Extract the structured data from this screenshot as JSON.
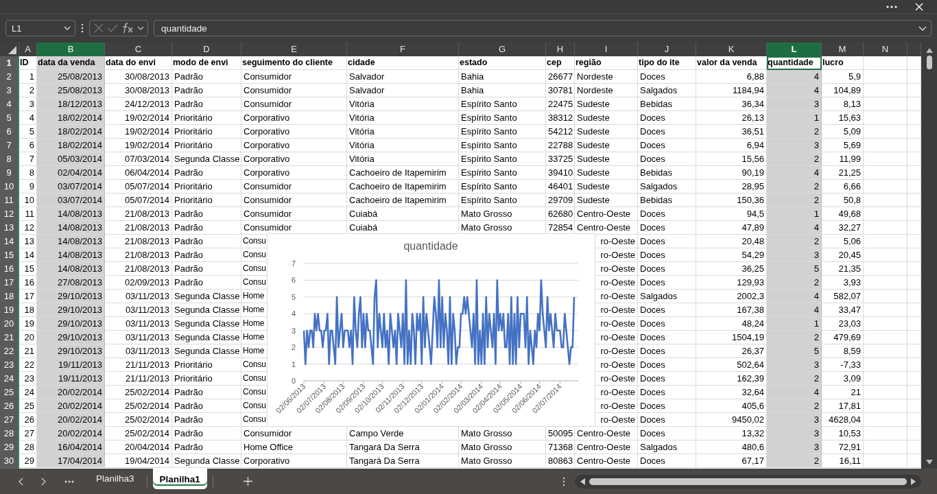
{
  "formula_bar": {
    "name_box": "L1",
    "formula": "quantidade"
  },
  "columns": [
    {
      "letter": "A",
      "selected": false,
      "active": false
    },
    {
      "letter": "B",
      "selected": true,
      "active": false
    },
    {
      "letter": "C",
      "selected": false,
      "active": false
    },
    {
      "letter": "D",
      "selected": false,
      "active": false
    },
    {
      "letter": "E",
      "selected": false,
      "active": false
    },
    {
      "letter": "F",
      "selected": false,
      "active": false
    },
    {
      "letter": "G",
      "selected": false,
      "active": false
    },
    {
      "letter": "H",
      "selected": false,
      "active": false
    },
    {
      "letter": "I",
      "selected": false,
      "active": false
    },
    {
      "letter": "J",
      "selected": false,
      "active": false
    },
    {
      "letter": "K",
      "selected": false,
      "active": false
    },
    {
      "letter": "L",
      "selected": true,
      "active": true
    },
    {
      "letter": "M",
      "selected": false,
      "active": false
    },
    {
      "letter": "N",
      "selected": false,
      "active": false
    }
  ],
  "rows": [
    {
      "number": "1",
      "kind": "header",
      "selected": true,
      "active": true,
      "cells": [
        "ID",
        "data da venda",
        "data do envi",
        "modo de envi",
        "seguimento do cliente",
        "cidade",
        "estado",
        "cep",
        "região",
        "tipo do ite",
        "valor da venda",
        "quantidade",
        "lucro"
      ]
    },
    {
      "number": "2",
      "kind": "data",
      "selected": true,
      "active": false,
      "cells": [
        "1",
        "25/08/2013",
        "30/08/2013",
        "Padrão",
        "Consumidor",
        "Salvador",
        "Bahia",
        "26677",
        "Nordeste",
        "Doces",
        "6,88",
        "4",
        "5,9"
      ]
    },
    {
      "number": "3",
      "kind": "data",
      "selected": true,
      "active": false,
      "cells": [
        "2",
        "25/08/2013",
        "30/08/2013",
        "Padrão",
        "Consumidor",
        "Salvador",
        "Bahia",
        "30781",
        "Nordeste",
        "Salgados",
        "1184,94",
        "4",
        "104,89"
      ]
    },
    {
      "number": "4",
      "kind": "data",
      "selected": true,
      "active": false,
      "cells": [
        "3",
        "18/12/2013",
        "24/12/2013",
        "Padrão",
        "Consumidor",
        "Vitória",
        "Espírito Santo",
        "22475",
        "Sudeste",
        "Bebidas",
        "36,34",
        "3",
        "8,13"
      ]
    },
    {
      "number": "5",
      "kind": "data",
      "selected": true,
      "active": false,
      "cells": [
        "4",
        "18/02/2014",
        "19/02/2014",
        "Prioritário",
        "Corporativo",
        "Vitória",
        "Espírito Santo",
        "38312",
        "Sudeste",
        "Doces",
        "26,13",
        "1",
        "15,63"
      ]
    },
    {
      "number": "6",
      "kind": "data",
      "selected": true,
      "active": false,
      "cells": [
        "5",
        "18/02/2014",
        "19/02/2014",
        "Prioritário",
        "Corporativo",
        "Vitória",
        "Espírito Santo",
        "54212",
        "Sudeste",
        "Doces",
        "36,51",
        "2",
        "5,09"
      ]
    },
    {
      "number": "7",
      "kind": "data",
      "selected": true,
      "active": false,
      "cells": [
        "6",
        "18/02/2014",
        "19/02/2014",
        "Prioritário",
        "Corporativo",
        "Vitória",
        "Espírito Santo",
        "22788",
        "Sudeste",
        "Doces",
        "6,94",
        "3",
        "5,69"
      ]
    },
    {
      "number": "8",
      "kind": "data",
      "selected": true,
      "active": false,
      "cells": [
        "7",
        "05/03/2014",
        "07/03/2014",
        "Segunda Classe",
        "Corporativo",
        "Vitória",
        "Espírito Santo",
        "33725",
        "Sudeste",
        "Doces",
        "15,56",
        "2",
        "11,99"
      ]
    },
    {
      "number": "9",
      "kind": "data",
      "selected": true,
      "active": false,
      "cells": [
        "8",
        "02/04/2014",
        "06/04/2014",
        "Padrão",
        "Corporativo",
        "Cachoeiro de Itapemirim",
        "Espírito Santo",
        "39410",
        "Sudeste",
        "Bebidas",
        "90,19",
        "4",
        "21,25"
      ]
    },
    {
      "number": "10",
      "kind": "data",
      "selected": true,
      "active": false,
      "cells": [
        "9",
        "03/07/2014",
        "05/07/2014",
        "Prioritário",
        "Consumidor",
        "Cachoeiro de Itapemirim",
        "Espírito Santo",
        "46401",
        "Sudeste",
        "Salgados",
        "28,95",
        "2",
        "6,66"
      ]
    },
    {
      "number": "11",
      "kind": "data",
      "selected": true,
      "active": false,
      "cells": [
        "10",
        "03/07/2014",
        "05/07/2014",
        "Prioritário",
        "Consumidor",
        "Cachoeiro de Itapemirim",
        "Espírito Santo",
        "29709",
        "Sudeste",
        "Bebidas",
        "150,36",
        "2",
        "50,8"
      ]
    },
    {
      "number": "12",
      "kind": "data",
      "selected": true,
      "active": false,
      "cells": [
        "11",
        "14/08/2013",
        "21/08/2013",
        "Padrão",
        "Consumidor",
        "Cuiabá",
        "Mato Grosso",
        "62680",
        "Centro-Oeste",
        "Doces",
        "94,5",
        "1",
        "49,68"
      ]
    },
    {
      "number": "13",
      "kind": "data",
      "selected": true,
      "active": false,
      "cells": [
        "12",
        "14/08/2013",
        "21/08/2013",
        "Padrão",
        "Consumidor",
        "Cuiabá",
        "Mato Grosso",
        "72854",
        "Centro-Oeste",
        "Doces",
        "47,89",
        "4",
        "32,27"
      ]
    },
    {
      "number": "14",
      "kind": "data",
      "selected": true,
      "active": false,
      "cells": [
        "13",
        "14/08/2013",
        "21/08/2013",
        "Padrão",
        "Consu",
        null,
        null,
        null,
        "ro-Oeste",
        "Doces",
        "20,48",
        "2",
        "5,06"
      ]
    },
    {
      "number": "15",
      "kind": "data",
      "selected": true,
      "active": false,
      "cells": [
        "14",
        "14/08/2013",
        "21/08/2013",
        "Padrão",
        "Consu",
        null,
        null,
        null,
        "ro-Oeste",
        "Doces",
        "54,29",
        "3",
        "20,45"
      ]
    },
    {
      "number": "16",
      "kind": "data",
      "selected": true,
      "active": false,
      "cells": [
        "15",
        "14/08/2013",
        "21/08/2013",
        "Padrão",
        "Consu",
        null,
        null,
        null,
        "ro-Oeste",
        "Doces",
        "36,25",
        "5",
        "21,35"
      ]
    },
    {
      "number": "17",
      "kind": "data",
      "selected": true,
      "active": false,
      "cells": [
        "16",
        "27/08/2013",
        "02/09/2013",
        "Padrão",
        "Consu",
        null,
        null,
        null,
        "ro-Oeste",
        "Doces",
        "129,93",
        "2",
        "3,93"
      ]
    },
    {
      "number": "18",
      "kind": "data",
      "selected": true,
      "active": false,
      "cells": [
        "17",
        "29/10/2013",
        "03/11/2013",
        "Segunda Classe",
        "Home",
        null,
        null,
        null,
        "ro-Oeste",
        "Salgados",
        "2002,3",
        "4",
        "582,07"
      ]
    },
    {
      "number": "19",
      "kind": "data",
      "selected": true,
      "active": false,
      "cells": [
        "18",
        "29/10/2013",
        "03/11/2013",
        "Segunda Classe",
        "Home",
        null,
        null,
        null,
        "ro-Oeste",
        "Doces",
        "167,38",
        "4",
        "33,47"
      ]
    },
    {
      "number": "20",
      "kind": "data",
      "selected": true,
      "active": false,
      "cells": [
        "19",
        "29/10/2013",
        "03/11/2013",
        "Segunda Classe",
        "Home",
        null,
        null,
        null,
        "ro-Oeste",
        "Doces",
        "48,24",
        "1",
        "23,03"
      ]
    },
    {
      "number": "21",
      "kind": "data",
      "selected": true,
      "active": false,
      "cells": [
        "20",
        "29/10/2013",
        "03/11/2013",
        "Segunda Classe",
        "Home",
        null,
        null,
        null,
        "ro-Oeste",
        "Doces",
        "1504,19",
        "2",
        "479,69"
      ]
    },
    {
      "number": "22",
      "kind": "data",
      "selected": true,
      "active": false,
      "cells": [
        "21",
        "29/10/2013",
        "03/11/2013",
        "Segunda Classe",
        "Home",
        null,
        null,
        null,
        "ro-Oeste",
        "Doces",
        "26,37",
        "5",
        "8,59"
      ]
    },
    {
      "number": "23",
      "kind": "data",
      "selected": true,
      "active": false,
      "cells": [
        "22",
        "19/11/2013",
        "21/11/2013",
        "Prioritário",
        "Consu",
        null,
        null,
        null,
        "ro-Oeste",
        "Doces",
        "502,64",
        "3",
        "-7,33"
      ]
    },
    {
      "number": "24",
      "kind": "data",
      "selected": true,
      "active": false,
      "cells": [
        "23",
        "19/11/2013",
        "21/11/2013",
        "Prioritário",
        "Consu",
        null,
        null,
        null,
        "ro-Oeste",
        "Doces",
        "162,39",
        "2",
        "3,09"
      ]
    },
    {
      "number": "25",
      "kind": "data",
      "selected": true,
      "active": false,
      "cells": [
        "24",
        "20/02/2014",
        "25/02/2014",
        "Padrão",
        "Consu",
        null,
        null,
        null,
        "ro-Oeste",
        "Doces",
        "32,64",
        "4",
        "21"
      ]
    },
    {
      "number": "26",
      "kind": "data",
      "selected": true,
      "active": false,
      "cells": [
        "25",
        "20/02/2014",
        "25/02/2014",
        "Padrão",
        "Consu",
        null,
        null,
        null,
        "ro-Oeste",
        "Doces",
        "405,6",
        "2",
        "17,81"
      ]
    },
    {
      "number": "27",
      "kind": "data",
      "selected": true,
      "active": false,
      "cells": [
        "26",
        "20/02/2014",
        "25/02/2014",
        "Padrão",
        "Consu",
        null,
        null,
        null,
        "ro-Oeste",
        "Doces",
        "9450,02",
        "3",
        "4628,04"
      ]
    },
    {
      "number": "28",
      "kind": "data",
      "selected": true,
      "active": false,
      "cells": [
        "27",
        "20/02/2014",
        "25/02/2014",
        "Padrão",
        "Consumidor",
        "Campo Verde",
        "Mato Grosso",
        "50095",
        "Centro-Oeste",
        "Doces",
        "13,32",
        "3",
        "10,53"
      ]
    },
    {
      "number": "29",
      "kind": "data",
      "selected": true,
      "active": false,
      "cells": [
        "28",
        "16/04/2014",
        "20/04/2014",
        "Padrão",
        "Home Office",
        "Tangará Da Serra",
        "Mato Grosso",
        "71368",
        "Centro-Oeste",
        "Salgados",
        "480,6",
        "3",
        "72,91"
      ]
    },
    {
      "number": "30",
      "kind": "data",
      "selected": true,
      "active": false,
      "cells": [
        "29",
        "17/04/2014",
        "19/04/2014",
        "Segunda Classe",
        "Corporativo",
        "Tangará Da Serra",
        "Mato Grosso",
        "80863",
        "Centro-Oeste",
        "Doces",
        "67,17",
        "2",
        "16,11"
      ]
    }
  ],
  "chart": {
    "chart_data": {
      "type": "line",
      "title": "quantidade",
      "grid": true,
      "ylim": [
        0,
        7
      ],
      "yticks": [
        0,
        1,
        2,
        3,
        4,
        5,
        6,
        7
      ],
      "categories": [
        "02/06/2013",
        null,
        null,
        null,
        null,
        null,
        null,
        null,
        null,
        null,
        null,
        null,
        null,
        "02/07/2013",
        null,
        null,
        null,
        null,
        null,
        null,
        null,
        null,
        null,
        null,
        null,
        "02/08/2013",
        null,
        null,
        null,
        null,
        null,
        null,
        null,
        null,
        null,
        null,
        null,
        null,
        "02/09/2013",
        null,
        null,
        null,
        null,
        null,
        null,
        null,
        null,
        null,
        null,
        null,
        "02/10/2013",
        null,
        null,
        null,
        null,
        null,
        null,
        null,
        null,
        null,
        null,
        null,
        null,
        "02/11/2013",
        null,
        null,
        null,
        null,
        null,
        null,
        null,
        null,
        null,
        null,
        null,
        "02/12/2013",
        null,
        null,
        null,
        null,
        null,
        null,
        null,
        null,
        null,
        null,
        null,
        null,
        "02/01/2014",
        null,
        null,
        null,
        null,
        null,
        null,
        null,
        null,
        null,
        null,
        null,
        "02/02/2014",
        null,
        null,
        null,
        null,
        null,
        null,
        null,
        null,
        null,
        null,
        null,
        null,
        "02/03/2014",
        null,
        null,
        null,
        null,
        null,
        null,
        null,
        null,
        null,
        null,
        null,
        "02/04/2014",
        null,
        null,
        null,
        null,
        null,
        null,
        null,
        null,
        null,
        null,
        null,
        null,
        "02/05/2014",
        null,
        null,
        null,
        null,
        null,
        null,
        null,
        null,
        null,
        null,
        null,
        "02/06/2014",
        null,
        null,
        null,
        null,
        null,
        null,
        null,
        null,
        null,
        null,
        null,
        null,
        "02/07/2014",
        null,
        null,
        null,
        null,
        null,
        null,
        null,
        null,
        null
      ],
      "series": [
        {
          "color": "#4472c4",
          "values": [
            3,
            1,
            3,
            2,
            3,
            3,
            2,
            4,
            3,
            4,
            3,
            3,
            2,
            3,
            3,
            4,
            1,
            3,
            3,
            2,
            1,
            5,
            2,
            3,
            4,
            2,
            3,
            3,
            3,
            2,
            3,
            1,
            5,
            3,
            2,
            4,
            5,
            2,
            4,
            2,
            4,
            3,
            3,
            2,
            1,
            5,
            6,
            2,
            4,
            3,
            2,
            4,
            2,
            3,
            1,
            4,
            3,
            2,
            3,
            1,
            4,
            3,
            2,
            4,
            1,
            6,
            1,
            3,
            1,
            4,
            3,
            1,
            4,
            3,
            4,
            1,
            5,
            2,
            4,
            3,
            2,
            1,
            3,
            5,
            4,
            2,
            6,
            2,
            5,
            2,
            4,
            3,
            1,
            5,
            1,
            4,
            3,
            1,
            2,
            2,
            4,
            4,
            5,
            4,
            5,
            4,
            3,
            2,
            4,
            1,
            6,
            1,
            3,
            1,
            4,
            1,
            5,
            2,
            4,
            3,
            2,
            4,
            1,
            6,
            3,
            4,
            3,
            4,
            2,
            2,
            4,
            1,
            5,
            1,
            4,
            1,
            5,
            2,
            4,
            4,
            4,
            2,
            5,
            1,
            3,
            2,
            1,
            3,
            2,
            4,
            3,
            6,
            4,
            3,
            2,
            5,
            3,
            4,
            3,
            2,
            4,
            3,
            3,
            3,
            2,
            2,
            4,
            3,
            2,
            1,
            2,
            2,
            5
          ]
        }
      ]
    }
  },
  "sheet_tabs": [
    {
      "label": "Planilha3",
      "selected": false
    },
    {
      "label": "Planilha1",
      "selected": true
    }
  ]
}
